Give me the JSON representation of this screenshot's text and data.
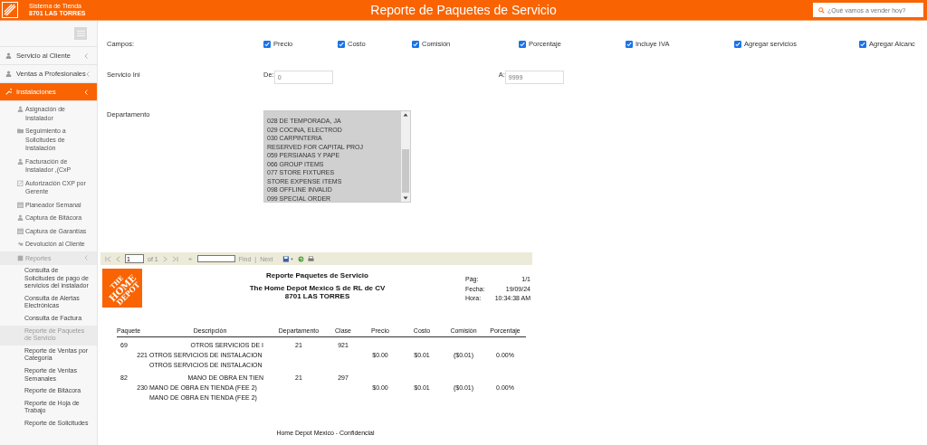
{
  "header": {
    "store_system": "Sistema de Tienda",
    "store_name": "8701 LAS TORRES",
    "title": "Reporte de Paquetes de Servicio",
    "search": {
      "placeholder": "¿Qué vamos a vender hoy?"
    }
  },
  "sidebar": {
    "items": [
      {
        "label": "Servicio al Cliente",
        "selected": false
      },
      {
        "label": "Ventas a Profesionales",
        "selected": false
      },
      {
        "label": "Instalaciones",
        "selected": true,
        "children": [
          {
            "label": "Asignación de Instalador",
            "selected": false
          },
          {
            "label": "Seguimiento a Solicitudes de Instalación",
            "selected": false
          },
          {
            "label": "Facturación de Instalador ,(CxP",
            "selected": false
          },
          {
            "label": "Autorización CXP por Gerente",
            "selected": false
          },
          {
            "label": "Planeador Semanal",
            "selected": false
          },
          {
            "label": "Captura de Bitácora",
            "selected": false
          },
          {
            "label": "Captura de Garantías",
            "selected": false
          },
          {
            "label": "Devolución al Cliente",
            "selected": false
          },
          {
            "label": "Reportes",
            "selected": false,
            "children": [
              {
                "label": "Consulta de Solicitudes de pago de servicios del instalador",
                "selected": false
              },
              {
                "label": "Consulta de Alertas Electrónicas",
                "selected": false
              },
              {
                "label": "Consulta de Factura",
                "selected": false
              },
              {
                "label": "Reporte de Paquetes de Servicio",
                "selected": true
              },
              {
                "label": "Reporte de Ventas por Categoría",
                "selected": false
              },
              {
                "label": "Reporte de Ventas Semanales",
                "selected": false
              },
              {
                "label": "Reporte de Bitácora",
                "selected": false
              },
              {
                "label": "Reporte de Hoja de Trabajo",
                "selected": false
              },
              {
                "label": "Reporte de Solicitudes",
                "selected": false
              }
            ]
          }
        ]
      }
    ]
  },
  "form": {
    "campos_label": "Campos:",
    "campos": [
      {
        "label": "Precio",
        "checked": true
      },
      {
        "label": "Costo",
        "checked": true
      },
      {
        "label": "Comisión",
        "checked": true
      },
      {
        "label": "Porcentaje",
        "checked": true
      },
      {
        "label": "Incluye IVA",
        "checked": true
      },
      {
        "label": "Agregar servicios",
        "checked": true
      },
      {
        "label": "Agregar Alcanc",
        "checked": true
      }
    ],
    "servicio_label": "Servicio Ini",
    "de_label": "De:",
    "de_value": "0",
    "a_label": "A:",
    "a_value": "9999",
    "departamento_label": "Departamento",
    "departamentos": [
      {
        "label": "028 DE TEMPORADA, JA",
        "selected": true
      },
      {
        "label": "029 COCINA, ELECTROD",
        "selected": true
      },
      {
        "label": "030 CARPINTERIA",
        "selected": true
      },
      {
        "label": "RESERVED FOR CAPITAL PROJ",
        "selected": true
      },
      {
        "label": "059 PERSIANAS Y PAPE",
        "selected": true
      },
      {
        "label": "066 GROUP ITEMS",
        "selected": true
      },
      {
        "label": "077 STORE FIXTURES",
        "selected": true
      },
      {
        "label": "STORE EXPENSE ITEMS",
        "selected": true
      },
      {
        "label": "098 OFFLINE INVALID",
        "selected": true
      },
      {
        "label": "099 SPECIAL ORDER",
        "selected": true
      }
    ]
  },
  "report_toolbar": {
    "page": "1",
    "of": "of 1",
    "find": "Find",
    "separator": "|",
    "next": "Next"
  },
  "report": {
    "logo_lines": [
      "THE",
      "HOME",
      "DEPOT"
    ],
    "title": "Reporte Paquetes de Servicio",
    "company": "The Home Depot Mexico S de RL de CV",
    "store": "8701  LAS TORRES",
    "meta": [
      {
        "label": "Pág:",
        "value": "1/1"
      },
      {
        "label": "Fecha:",
        "value": "19/09/24"
      },
      {
        "label": "Hora:",
        "value": "10:34:38 AM"
      }
    ],
    "columns": [
      "Paquete",
      "Descripción",
      "Departamento",
      "Clase",
      "Precio",
      "Costo",
      "Comisión",
      "Porcentaje"
    ],
    "rows": [
      {
        "kind": "group",
        "paquete": "69",
        "descripcion": "OTROS SERVICIOS DE I",
        "departamento": "21",
        "clase": "921"
      },
      {
        "kind": "item",
        "paquete": "221",
        "descripcion": "OTROS SERVICIOS DE INSTALACION",
        "precio": "$0.00",
        "costo": "$0.01",
        "comision": "($0.01)",
        "porcentaje": "0.00%"
      },
      {
        "kind": "note",
        "descripcion": "OTROS SERVICIOS DE INSTALACION"
      },
      {
        "kind": "group",
        "paquete": "82",
        "descripcion": "MANO DE OBRA EN TIEN",
        "departamento": "21",
        "clase": "297"
      },
      {
        "kind": "item",
        "paquete": "230",
        "descripcion": "MANO DE OBRA EN TIENDA (FEE 2)",
        "precio": "$0.00",
        "costo": "$0.01",
        "comision": "($0.01)",
        "porcentaje": "0.00%"
      },
      {
        "kind": "note",
        "descripcion": "MANO DE OBRA EN TIENDA (FEE 2)"
      }
    ],
    "footer": "Home Depot Mexico - Confidencial"
  }
}
